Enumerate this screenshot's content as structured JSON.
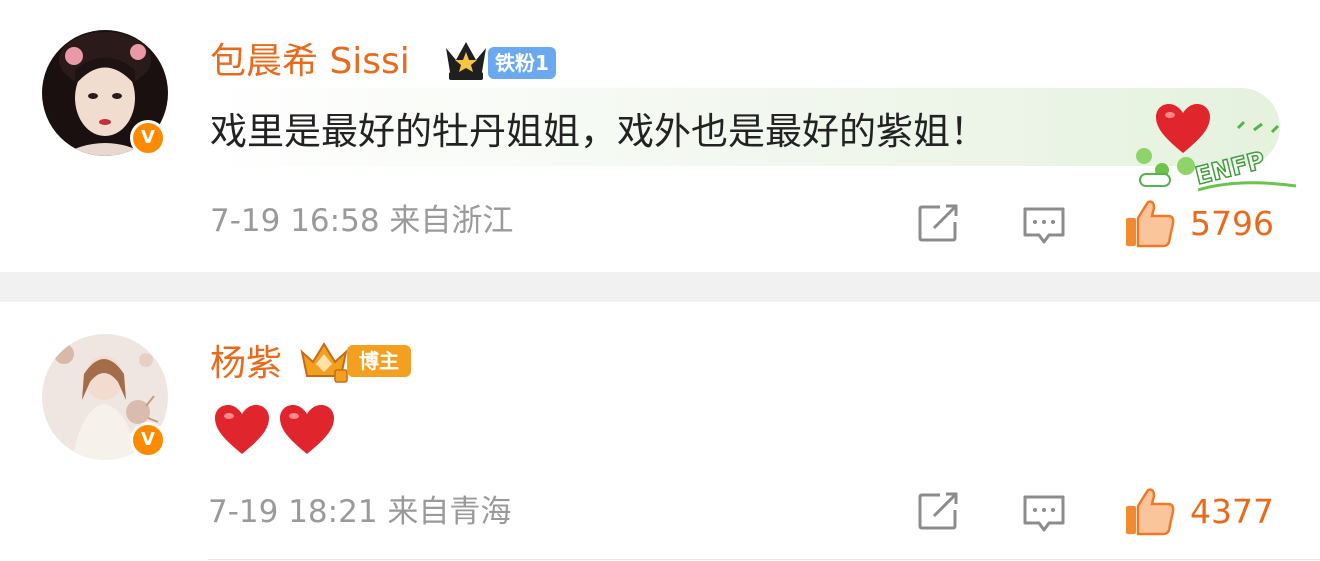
{
  "comments": [
    {
      "username": "包晨希 Sissi",
      "fan_badge": "铁粉1",
      "text": "戏里是最好的牡丹姐姐，戏外也是最好的紫姐！",
      "time": "7-19 16:58",
      "location": "来自浙江",
      "likes": "5796",
      "verified_badge": "V",
      "decoration_text": "ENFP",
      "bubble_color": "#e5f2de",
      "icons": [
        "crown-icon",
        "heart-emoji",
        "share-icon",
        "reply-icon",
        "thumbs-up-icon"
      ]
    },
    {
      "username": "杨紫",
      "author_badge": "博主",
      "time": "7-19 18:21",
      "location": "来自青海",
      "likes": "4377",
      "verified_badge": "V",
      "icons": [
        "crown-icon",
        "heart-emoji",
        "heart-emoji",
        "share-icon",
        "reply-icon",
        "thumbs-up-icon"
      ]
    }
  ],
  "colors": {
    "name": "#e86a1d",
    "likes": "#e86a1d",
    "meta": "#9a9a9a",
    "fan_badge": "#6aa8ef",
    "host_badge": "#f3a021",
    "verified": "#ff8a00"
  }
}
